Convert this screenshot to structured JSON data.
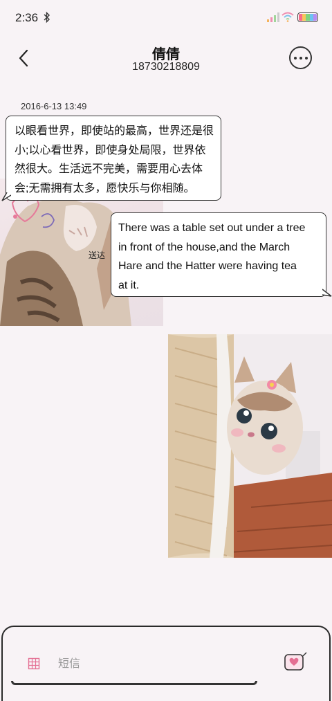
{
  "status_bar": {
    "time": "2:36",
    "icons": [
      "bluetooth-icon",
      "signal-icon",
      "wifi-icon",
      "battery-icon"
    ]
  },
  "header": {
    "contact_name": "倩倩",
    "contact_number": "18730218809",
    "back_icon": "chevron-left-icon",
    "more_icon": "more-horizontal-icon"
  },
  "conversation": {
    "timestamp": "2016-6-13 13:49",
    "messages": [
      {
        "direction": "incoming",
        "lines": [
          "以眼看世界，即使站的最高，世界还是很",
          "小;以心看世界，即使身处局限，世界依",
          "然很大。生活远不完美，需要用心去体",
          "会;无需拥有太多，愿快乐与你相随。"
        ]
      },
      {
        "direction": "outgoing",
        "lines": [
          "There was a table set out under a tree",
          "in front of the house,and the March",
          "Hare and the Hatter were having tea",
          "at it."
        ]
      }
    ],
    "delivery_status": "送达"
  },
  "composer": {
    "placeholder": "短信",
    "attach_icon": "grid-icon",
    "send_icon": "heart-message-icon"
  },
  "colors": {
    "background": "#f8f3f6",
    "bubble": "#ffffff",
    "border": "#333333",
    "accent_pink": "#e46f93"
  }
}
